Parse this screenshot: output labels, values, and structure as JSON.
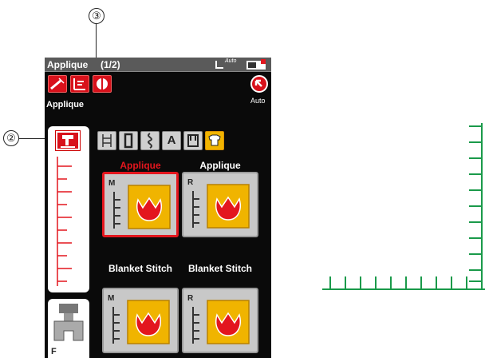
{
  "callouts": {
    "upper": "③",
    "left": "②"
  },
  "screen": {
    "title": "Applique",
    "page": "(1/2)",
    "thread_auto_label": "Auto",
    "mode_label": "Applique",
    "auto_label": "Auto",
    "cat_text_icon": "A"
  },
  "stitches": [
    {
      "name": "Applique",
      "mode": "M",
      "selected": true
    },
    {
      "name": "Applique",
      "mode": "R",
      "selected": false
    },
    {
      "name": "Blanket Stitch",
      "mode": "M",
      "selected": false
    },
    {
      "name": "Blanket Stitch",
      "mode": "R",
      "selected": false
    }
  ],
  "foot_letter": "F",
  "icons": [
    "thread-tension-icon",
    "bobbin-icon",
    "twin-needle-icon",
    "elongation-icon",
    "mirror-icon",
    "memory-back-icon",
    "applique-foot-icon",
    "presser-foot-icon",
    "category-icons"
  ],
  "colors": {
    "accent_red": "#e3161e",
    "highlight_yellow": "#f0b400",
    "diagram_green": "#1a9a4a"
  }
}
